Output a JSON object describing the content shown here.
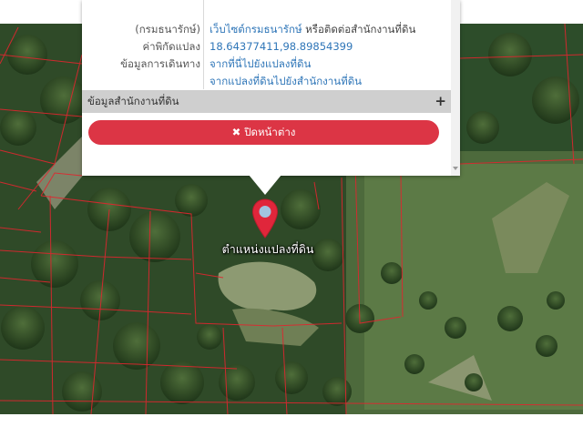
{
  "popup": {
    "rows": [
      {
        "label": "(กรมธนารักษ์)",
        "link": "เว็บไซต์กรมธนารักษ์",
        "suffix": " หรือติดต่อสำนักงานที่ดิน"
      },
      {
        "label": "ค่าพิกัดแปลง",
        "value": "18.64377411,98.89854399"
      },
      {
        "label": "ข้อมูลการเดินทาง",
        "value": "จากที่นี่ไปยังแปลงที่ดิน"
      },
      {
        "label": "",
        "value": "จากแปลงที่ดินไปยังสำนักงานที่ดิน"
      }
    ],
    "section_header": "ข้อมูลสำนักงานที่ดิน",
    "expand_icon": "plus-icon",
    "close_label": "ปิดหน้าต่าง",
    "close_icon": "close-icon"
  },
  "marker": {
    "label": "ตำแหน่งแปลงที่ดิน",
    "icon": "map-pin-icon",
    "color": "#e0263b"
  },
  "colors": {
    "accent_red": "#dc3545",
    "link_blue": "#2f76b8",
    "parcel_line": "#e0262f"
  }
}
